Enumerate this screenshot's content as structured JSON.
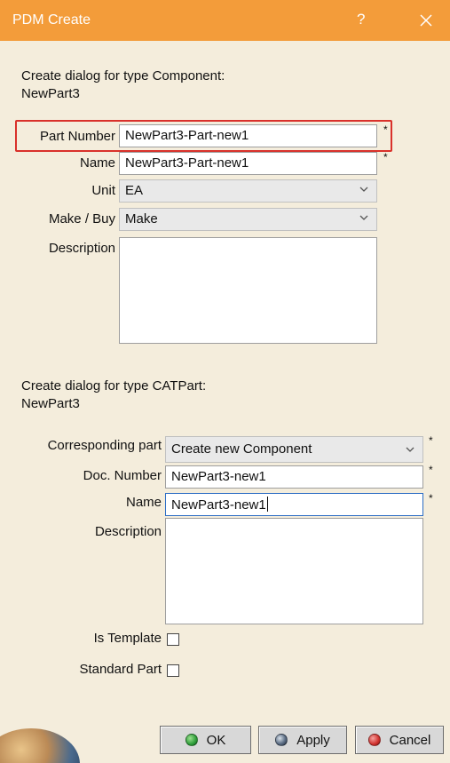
{
  "window": {
    "title": "PDM Create",
    "help_label": "?",
    "close_label": "Close"
  },
  "component": {
    "heading_line1": "Create dialog for type Component:",
    "heading_line2": "NewPart3",
    "part_number_label": "Part Number",
    "part_number_value": "NewPart3-Part-new1",
    "name_label": "Name",
    "name_value": "NewPart3-Part-new1",
    "unit_label": "Unit",
    "unit_value": "EA",
    "make_buy_label": "Make / Buy",
    "make_buy_value": "Make",
    "description_label": "Description",
    "description_value": "",
    "required_marker": "*"
  },
  "catpart": {
    "heading_line1": "Create dialog for type CATPart:",
    "heading_line2": "NewPart3",
    "corresponding_part_label": "Corresponding part",
    "corresponding_part_value": "Create new Component",
    "doc_number_label": "Doc. Number",
    "doc_number_value": "NewPart3-new1",
    "name_label": "Name",
    "name_value": "NewPart3-new1",
    "description_label": "Description",
    "description_value": "",
    "is_template_label": "Is Template",
    "is_template_checked": false,
    "standard_part_label": "Standard Part",
    "standard_part_checked": false,
    "required_marker": "*"
  },
  "buttons": {
    "ok_label": "OK",
    "ok_color": "#2e9e3a",
    "apply_label": "Apply",
    "apply_color": "#2a3f5a",
    "cancel_label": "Cancel",
    "cancel_color": "#d0312d"
  },
  "colors": {
    "titlebar": "#f39c3a",
    "background": "#f4eddc",
    "highlight": "#d9312b"
  }
}
